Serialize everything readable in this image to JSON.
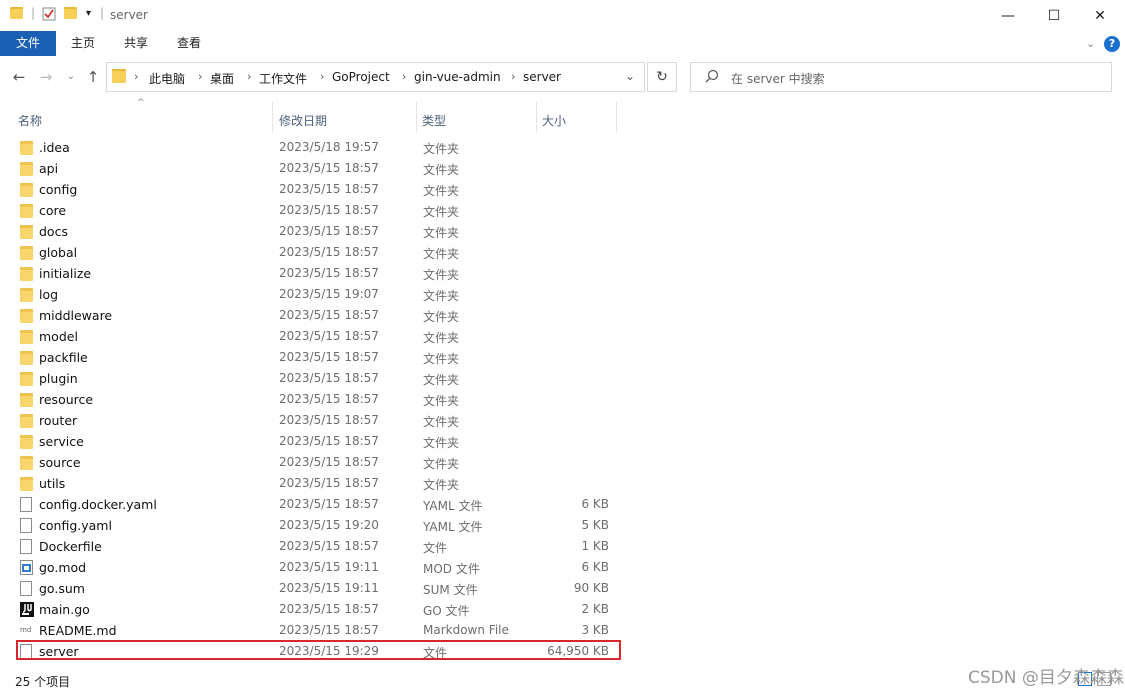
{
  "window": {
    "title": "server",
    "minimize": "—",
    "maximize": "☐",
    "close": "✕"
  },
  "ribbon": {
    "tabs": [
      "文件",
      "主页",
      "共享",
      "查看"
    ],
    "help": "?"
  },
  "nav": {
    "back": "←",
    "forward": "→",
    "up": "↑"
  },
  "address": {
    "crumbs": [
      "此电脑",
      "桌面",
      "工作文件",
      "GoProject",
      "gin-vue-admin",
      "server"
    ]
  },
  "search": {
    "placeholder": "在 server 中搜索"
  },
  "columns": {
    "name": "名称",
    "date": "修改日期",
    "type": "类型",
    "size": "大小"
  },
  "files": [
    {
      "name": ".idea",
      "date": "2023/5/18 19:57",
      "type": "文件夹",
      "size": "",
      "icon": "folder-icon"
    },
    {
      "name": "api",
      "date": "2023/5/15 18:57",
      "type": "文件夹",
      "size": "",
      "icon": "folder-icon"
    },
    {
      "name": "config",
      "date": "2023/5/15 18:57",
      "type": "文件夹",
      "size": "",
      "icon": "folder-icon"
    },
    {
      "name": "core",
      "date": "2023/5/15 18:57",
      "type": "文件夹",
      "size": "",
      "icon": "folder-icon"
    },
    {
      "name": "docs",
      "date": "2023/5/15 18:57",
      "type": "文件夹",
      "size": "",
      "icon": "folder-icon"
    },
    {
      "name": "global",
      "date": "2023/5/15 18:57",
      "type": "文件夹",
      "size": "",
      "icon": "folder-icon"
    },
    {
      "name": "initialize",
      "date": "2023/5/15 18:57",
      "type": "文件夹",
      "size": "",
      "icon": "folder-icon"
    },
    {
      "name": "log",
      "date": "2023/5/15 19:07",
      "type": "文件夹",
      "size": "",
      "icon": "folder-icon"
    },
    {
      "name": "middleware",
      "date": "2023/5/15 18:57",
      "type": "文件夹",
      "size": "",
      "icon": "folder-icon"
    },
    {
      "name": "model",
      "date": "2023/5/15 18:57",
      "type": "文件夹",
      "size": "",
      "icon": "folder-icon"
    },
    {
      "name": "packfile",
      "date": "2023/5/15 18:57",
      "type": "文件夹",
      "size": "",
      "icon": "folder-icon"
    },
    {
      "name": "plugin",
      "date": "2023/5/15 18:57",
      "type": "文件夹",
      "size": "",
      "icon": "folder-icon"
    },
    {
      "name": "resource",
      "date": "2023/5/15 18:57",
      "type": "文件夹",
      "size": "",
      "icon": "folder-icon"
    },
    {
      "name": "router",
      "date": "2023/5/15 18:57",
      "type": "文件夹",
      "size": "",
      "icon": "folder-icon"
    },
    {
      "name": "service",
      "date": "2023/5/15 18:57",
      "type": "文件夹",
      "size": "",
      "icon": "folder-icon"
    },
    {
      "name": "source",
      "date": "2023/5/15 18:57",
      "type": "文件夹",
      "size": "",
      "icon": "folder-icon"
    },
    {
      "name": "utils",
      "date": "2023/5/15 18:57",
      "type": "文件夹",
      "size": "",
      "icon": "folder-icon"
    },
    {
      "name": "config.docker.yaml",
      "date": "2023/5/15 18:57",
      "type": "YAML 文件",
      "size": "6 KB",
      "icon": "file-icon"
    },
    {
      "name": "config.yaml",
      "date": "2023/5/15 19:20",
      "type": "YAML 文件",
      "size": "5 KB",
      "icon": "file-icon"
    },
    {
      "name": "Dockerfile",
      "date": "2023/5/15 18:57",
      "type": "文件",
      "size": "1 KB",
      "icon": "file-icon"
    },
    {
      "name": "go.mod",
      "date": "2023/5/15 19:11",
      "type": "MOD 文件",
      "size": "6 KB",
      "icon": "mod-file-icon"
    },
    {
      "name": "go.sum",
      "date": "2023/5/15 19:11",
      "type": "SUM 文件",
      "size": "90 KB",
      "icon": "file-icon"
    },
    {
      "name": "main.go",
      "date": "2023/5/15 18:57",
      "type": "GO 文件",
      "size": "2 KB",
      "icon": "go-file-icon"
    },
    {
      "name": "README.md",
      "date": "2023/5/15 18:57",
      "type": "Markdown File",
      "size": "3 KB",
      "icon": "markdown-file-icon"
    },
    {
      "name": "server",
      "date": "2023/5/15 19:29",
      "type": "文件",
      "size": "64,950 KB",
      "icon": "file-icon"
    }
  ],
  "status": {
    "count": "25 个项目"
  },
  "watermark": "CSDN @目夕森森森",
  "colors": {
    "file_tab": "#1a5fb4",
    "highlight_border": "#d9262c",
    "folder": "#f9d66b"
  }
}
